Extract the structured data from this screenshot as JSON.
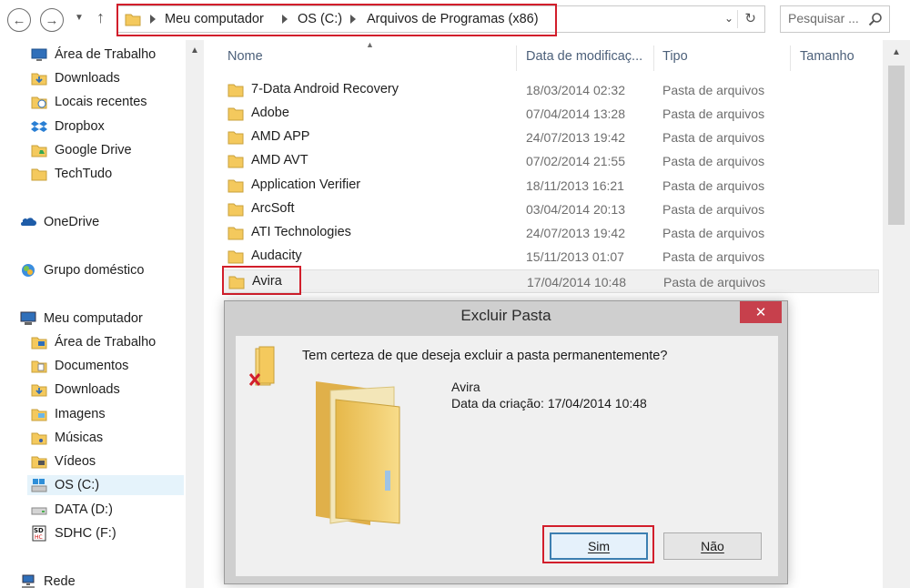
{
  "address": {
    "crumbs": [
      "Meu computador",
      "OS (C:)",
      "Arquivos de Programas (x86)"
    ]
  },
  "search": {
    "placeholder": "Pesquisar ..."
  },
  "nav": {
    "favorites": [
      "Área de Trabalho",
      "Downloads",
      "Locais recentes",
      "Dropbox",
      "Google Drive",
      "TechTudo"
    ],
    "onedrive": "OneDrive",
    "homegroup": "Grupo doméstico",
    "computer": "Meu computador",
    "computer_items": [
      "Área de Trabalho",
      "Documentos",
      "Downloads",
      "Imagens",
      "Músicas",
      "Vídeos",
      "OS (C:)",
      "DATA (D:)",
      "SDHC (F:)"
    ],
    "network": "Rede"
  },
  "columns": {
    "name": "Nome",
    "date": "Data de modificaç...",
    "type": "Tipo",
    "size": "Tamanho"
  },
  "files": [
    {
      "name": "7-Data Android Recovery",
      "date": "18/03/2014 02:32",
      "type": "Pasta de arquivos"
    },
    {
      "name": "Adobe",
      "date": "07/04/2014 13:28",
      "type": "Pasta de arquivos"
    },
    {
      "name": "AMD APP",
      "date": "24/07/2013 19:42",
      "type": "Pasta de arquivos"
    },
    {
      "name": "AMD AVT",
      "date": "07/02/2014 21:55",
      "type": "Pasta de arquivos"
    },
    {
      "name": "Application Verifier",
      "date": "18/11/2013 16:21",
      "type": "Pasta de arquivos"
    },
    {
      "name": "ArcSoft",
      "date": "03/04/2014 20:13",
      "type": "Pasta de arquivos"
    },
    {
      "name": "ATI Technologies",
      "date": "24/07/2013 19:42",
      "type": "Pasta de arquivos"
    },
    {
      "name": "Audacity",
      "date": "15/11/2013 01:07",
      "type": "Pasta de arquivos"
    },
    {
      "name": "Avira",
      "date": "17/04/2014 10:48",
      "type": "Pasta de arquivos"
    }
  ],
  "dialog": {
    "title": "Excluir Pasta",
    "close": "✕",
    "question": "Tem certeza de que deseja excluir a pasta permanentemente?",
    "folder_name": "Avira",
    "created": "Data da criação: 17/04/2014 10:48",
    "yes": "Sim",
    "no": "Não"
  },
  "colors": {
    "highlight": "#d21e2b",
    "folder": "#f4c95d",
    "close_button": "#c7404c"
  }
}
